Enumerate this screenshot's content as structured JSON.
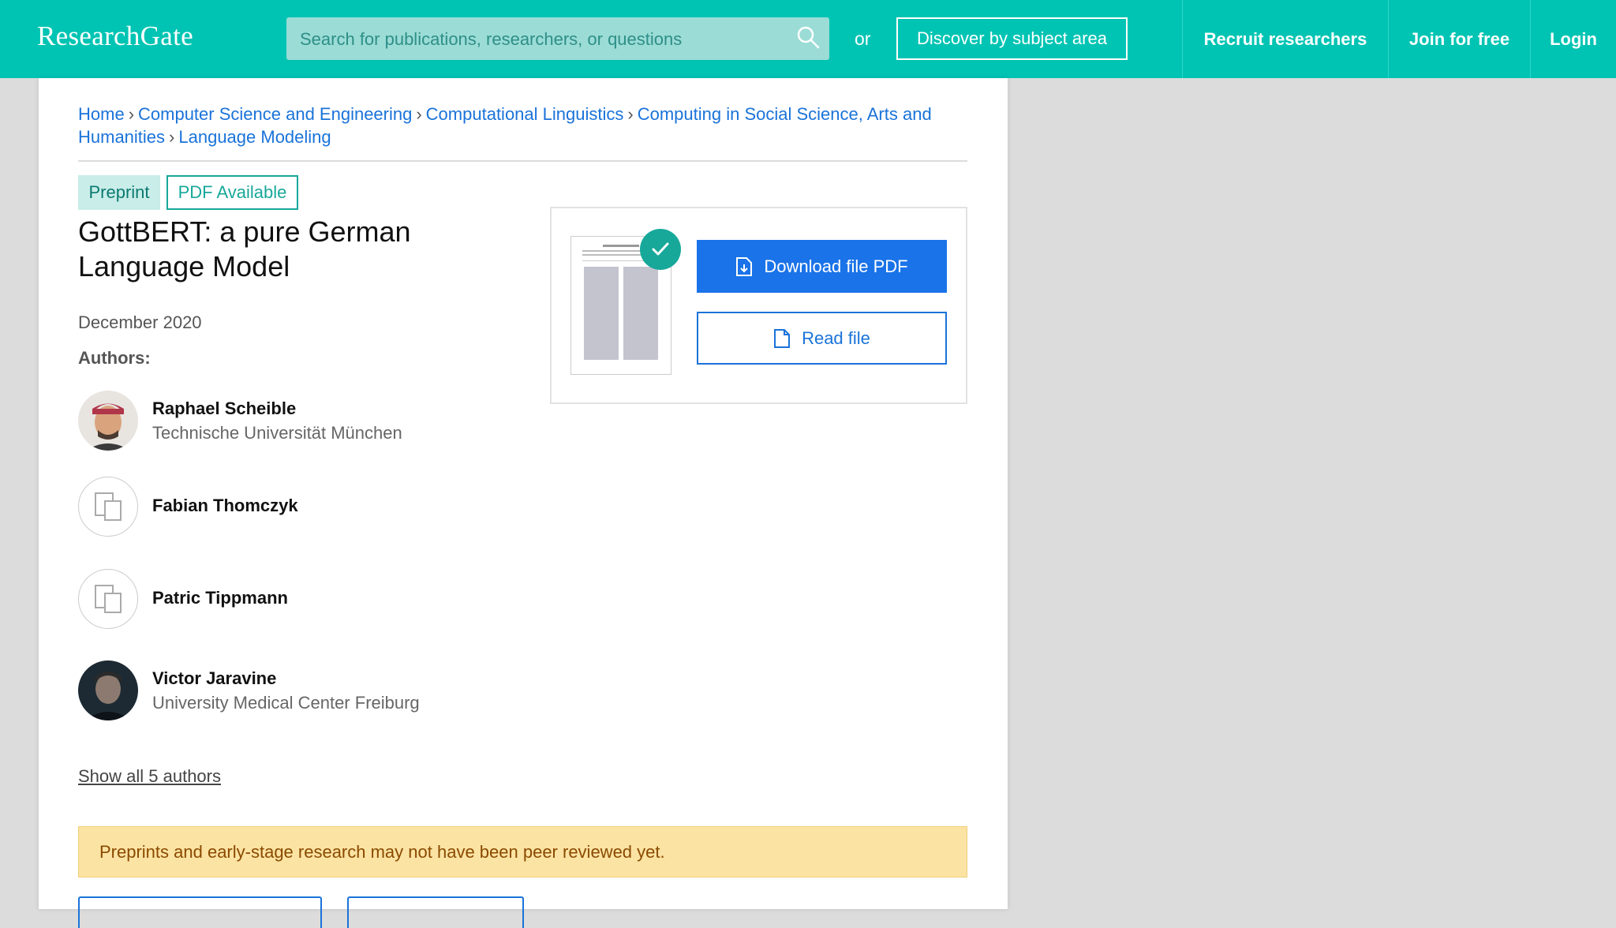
{
  "header": {
    "logo": "ResearchGate",
    "search_placeholder": "Search for publications, researchers, or questions",
    "or_label": "or",
    "discover_label": "Discover by subject area",
    "nav": [
      "Recruit researchers",
      "Join for free",
      "Login"
    ],
    "accent_color": "#00c4b3"
  },
  "breadcrumb": [
    "Home",
    "Computer Science and Engineering",
    "Computational Linguistics",
    "Computing in Social Science, Arts and Humanities",
    "Language Modeling"
  ],
  "tags": {
    "preprint": "Preprint",
    "pdf": "PDF Available"
  },
  "paper": {
    "title": "GottBERT: a pure German Language Model",
    "date": "December 2020",
    "authors_label": "Authors:"
  },
  "authors": [
    {
      "name": "Raphael Scheible",
      "affiliation": "Technische Universität München",
      "avatar": "photo"
    },
    {
      "name": "Fabian Thomczyk",
      "affiliation": "",
      "avatar": "placeholder"
    },
    {
      "name": "Patric Tippmann",
      "affiliation": "",
      "avatar": "placeholder"
    },
    {
      "name": "Victor Jaravine",
      "affiliation": "University Medical Center Freiburg",
      "avatar": "photo"
    }
  ],
  "show_all": "Show all 5 authors",
  "notice": "Preprints and early-stage research may not have been peer reviewed yet.",
  "actions": {
    "download": "Download file PDF",
    "read": "Read file"
  }
}
